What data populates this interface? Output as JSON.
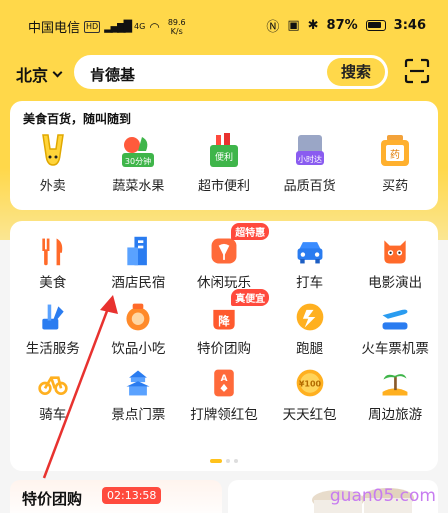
{
  "status": {
    "carrier": "中国电信",
    "hd": "HD",
    "network": "4G",
    "speed_value": "89.6",
    "speed_unit": "K/s",
    "battery": "87%",
    "time": "3:46"
  },
  "search": {
    "city": "北京",
    "query": "肯德基",
    "button": "搜索"
  },
  "food_section": {
    "title": "美食百货，随叫随到",
    "items": [
      {
        "label": "外卖",
        "icon": "takeout-icon"
      },
      {
        "label": "蔬菜水果",
        "icon": "vegetables-icon",
        "tag": "30分钟"
      },
      {
        "label": "超市便利",
        "icon": "supermarket-icon",
        "tag": "便利"
      },
      {
        "label": "品质百货",
        "icon": "department-store-icon",
        "tag": "小时达"
      },
      {
        "label": "买药",
        "icon": "medicine-icon",
        "tag": "药"
      }
    ]
  },
  "services": {
    "items": [
      {
        "label": "美食",
        "icon": "food-icon"
      },
      {
        "label": "酒店民宿",
        "icon": "hotel-icon"
      },
      {
        "label": "休闲玩乐",
        "icon": "leisure-icon",
        "badge": "超特惠"
      },
      {
        "label": "打车",
        "icon": "taxi-icon"
      },
      {
        "label": "电影演出",
        "icon": "movie-icon"
      },
      {
        "label": "生活服务",
        "icon": "life-service-icon"
      },
      {
        "label": "饮品小吃",
        "icon": "drinks-icon"
      },
      {
        "label": "特价团购",
        "icon": "group-buy-icon",
        "badge": "真便宜",
        "inner": "降"
      },
      {
        "label": "跑腿",
        "icon": "errand-icon"
      },
      {
        "label": "火车票机票",
        "icon": "train-plane-icon"
      },
      {
        "label": "骑车",
        "icon": "bike-icon"
      },
      {
        "label": "景点门票",
        "icon": "attraction-icon"
      },
      {
        "label": "打牌领红包",
        "icon": "cards-icon",
        "inner": "A"
      },
      {
        "label": "天天红包",
        "icon": "red-packet-icon",
        "inner": "¥100"
      },
      {
        "label": "周边旅游",
        "icon": "travel-icon"
      }
    ]
  },
  "deals": {
    "title": "特价团购",
    "timer": "02:13:58"
  },
  "watermark": "guan05.com",
  "colors": {
    "brand_yellow": "#ffd84a",
    "accent_red": "#ff4a3d",
    "annotation_red": "#e8322f"
  }
}
